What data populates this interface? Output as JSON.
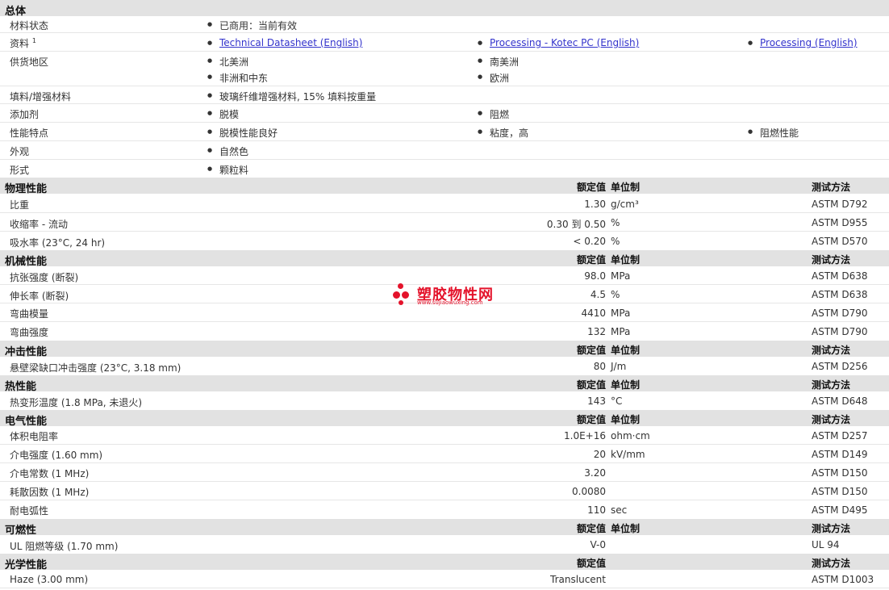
{
  "general": {
    "title": "总体",
    "rows": [
      {
        "label": "材料状态",
        "items": [
          "已商用：当前有效"
        ]
      },
      {
        "label": "资料",
        "sup": "1",
        "links": [
          "Technical Datasheet (English)",
          "Processing - Kotec PC (English)",
          "Processing (English)"
        ]
      },
      {
        "label": "供货地区",
        "items": [
          "北美洲",
          "南美洲",
          "非洲和中东",
          "欧洲"
        ]
      },
      {
        "label": "填料/增强材料",
        "items": [
          "玻璃纤维增强材料, 15% 填料按重量"
        ]
      },
      {
        "label": "添加剂",
        "items": [
          "脱模",
          "阻燃"
        ]
      },
      {
        "label": "性能特点",
        "items": [
          "脱模性能良好",
          "粘度，高",
          "阻燃性能"
        ]
      },
      {
        "label": "外观",
        "items": [
          "自然色"
        ]
      },
      {
        "label": "形式",
        "items": [
          "颗粒料"
        ]
      }
    ]
  },
  "col_headers": {
    "value": "额定值",
    "unit": "单位制",
    "method": "测试方法"
  },
  "sections": [
    {
      "title": "物理性能",
      "rows": [
        {
          "label": "比重",
          "value": "1.30",
          "unit": "g/cm³",
          "method": "ASTM D792"
        },
        {
          "label": "收缩率 - 流动",
          "value": "0.30 到  0.50",
          "unit": "%",
          "method": "ASTM D955"
        },
        {
          "label": "吸水率 (23°C, 24 hr)",
          "value": "< 0.20",
          "unit": "%",
          "method": "ASTM D570"
        }
      ]
    },
    {
      "title": "机械性能",
      "rows": [
        {
          "label": "抗张强度 (断裂)",
          "value": "98.0",
          "unit": "MPa",
          "method": "ASTM D638"
        },
        {
          "label": "伸长率 (断裂)",
          "value": "4.5",
          "unit": "%",
          "method": "ASTM D638"
        },
        {
          "label": "弯曲模量",
          "value": "4410",
          "unit": "MPa",
          "method": "ASTM D790"
        },
        {
          "label": "弯曲强度",
          "value": "132",
          "unit": "MPa",
          "method": "ASTM D790"
        }
      ]
    },
    {
      "title": "冲击性能",
      "rows": [
        {
          "label": "悬壁梁缺口冲击强度 (23°C, 3.18 mm)",
          "value": "80",
          "unit": "J/m",
          "method": "ASTM D256"
        }
      ]
    },
    {
      "title": "热性能",
      "rows": [
        {
          "label": "热变形温度 (1.8 MPa, 未退火)",
          "value": "143",
          "unit": "°C",
          "method": "ASTM D648"
        }
      ]
    },
    {
      "title": "电气性能",
      "rows": [
        {
          "label": "体积电阻率",
          "value": "1.0E+16",
          "unit": "ohm·cm",
          "method": "ASTM D257"
        },
        {
          "label": "介电强度 (1.60 mm)",
          "value": "20",
          "unit": "kV/mm",
          "method": "ASTM D149"
        },
        {
          "label": "介电常数 (1 MHz)",
          "value": "3.20",
          "unit": "",
          "method": "ASTM D150"
        },
        {
          "label": "耗散因数 (1 MHz)",
          "value": "0.0080",
          "unit": "",
          "method": "ASTM D150"
        },
        {
          "label": "耐电弧性",
          "value": "110",
          "unit": "sec",
          "method": "ASTM D495"
        }
      ]
    },
    {
      "title": "可燃性",
      "rows": [
        {
          "label": "UL 阻燃等级 (1.70 mm)",
          "value": "V-0",
          "unit": "",
          "method": "UL 94"
        }
      ]
    },
    {
      "title": "光学性能",
      "rows": [
        {
          "label": "Haze (3.00 mm)",
          "value": "Translucent",
          "unit": "",
          "method": "ASTM D1003"
        }
      ]
    }
  ],
  "watermark": {
    "name": "塑胶物性网",
    "url": "www.sujiaowuxing.com"
  }
}
